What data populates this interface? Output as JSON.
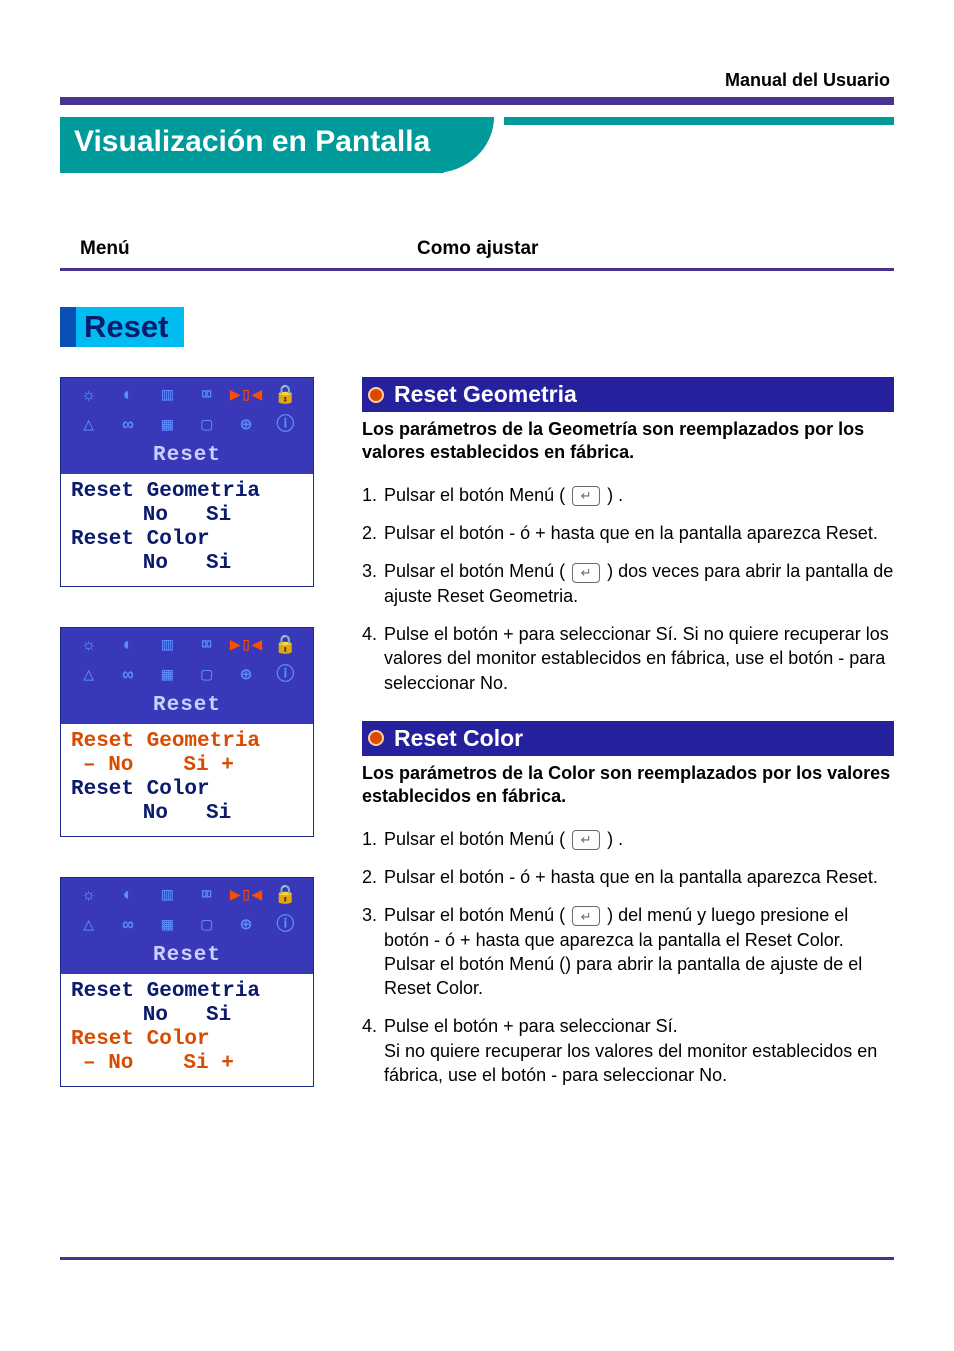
{
  "header": {
    "manual": "Manual del Usuario"
  },
  "page_title": "Visualización en Pantalla",
  "columns": {
    "menu": "Menú",
    "how": "Como ajustar"
  },
  "section_chip": "Reset",
  "osd": {
    "title": "Reset",
    "items": {
      "geom": "Reset Geometria",
      "color": "Reset Color",
      "no": "No",
      "si": "Si",
      "minus_no": "– No",
      "si_plus": "Si +"
    }
  },
  "geom": {
    "title": "Reset Geometria",
    "sub": "Los parámetros de la Geometría son reemplazados por los valores establecidos en fábrica.",
    "steps": {
      "s1a": "Pulsar el botón Menú (",
      "s1b": ") .",
      "s2": "Pulsar el botón - ó + hasta que en la pantalla aparezca Reset.",
      "s3a": "Pulsar el botón Menú (",
      "s3b": ") dos veces para abrir la pantalla de ajuste Reset Geometria.",
      "s4": "Pulse el botón + para seleccionar Sí. Si no quiere recuperar los valores del monitor establecidos en fábrica, use el botón - para seleccionar No."
    }
  },
  "color": {
    "title": "Reset Color",
    "sub": "Los parámetros de la Color son reemplazados por los valores establecidos en fábrica.",
    "steps": {
      "s1a": "Pulsar el botón Menú (",
      "s1b": ") .",
      "s2": "Pulsar el botón - ó + hasta que en la pantalla aparezca Reset.",
      "s3a": "Pulsar el botón Menú (",
      "s3b": ") del menú y luego presione el botón - ó + hasta que aparezca la pantalla el Reset Color. Pulsar el botón Menú () para abrir la pantalla de ajuste de el Reset Color.",
      "s4a": "Pulse el botón + para seleccionar Sí.",
      "s4b": "Si no quiere recuperar los valores del monitor establecidos en fábrica, use el botón - para seleccionar No."
    }
  },
  "icons": {
    "enter": "↵"
  }
}
